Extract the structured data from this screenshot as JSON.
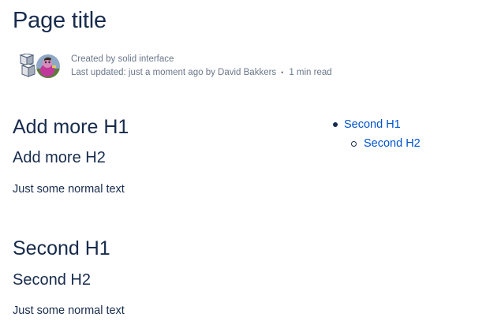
{
  "page": {
    "title": "Page title"
  },
  "byline": {
    "created_by": "Created by solid interface",
    "last_updated": "Last updated: just a moment ago by David Bakkers",
    "read_time": "1 min read"
  },
  "sections": [
    {
      "h1": "Add more H1",
      "h2": "Add more H2",
      "text": "Just some normal text"
    },
    {
      "h1": "Second H1",
      "h2": "Second H2",
      "text": "Just some normal text"
    }
  ],
  "toc": {
    "items": [
      {
        "label": "Second H1",
        "level": 1
      },
      {
        "label": "Second H2",
        "level": 2
      }
    ]
  },
  "colors": {
    "text": "#172b4d",
    "meta": "#6b778c",
    "link": "#0052cc"
  },
  "icons": {
    "app_avatar": "cube-stack-icon",
    "user_avatar": "user-avatar"
  }
}
